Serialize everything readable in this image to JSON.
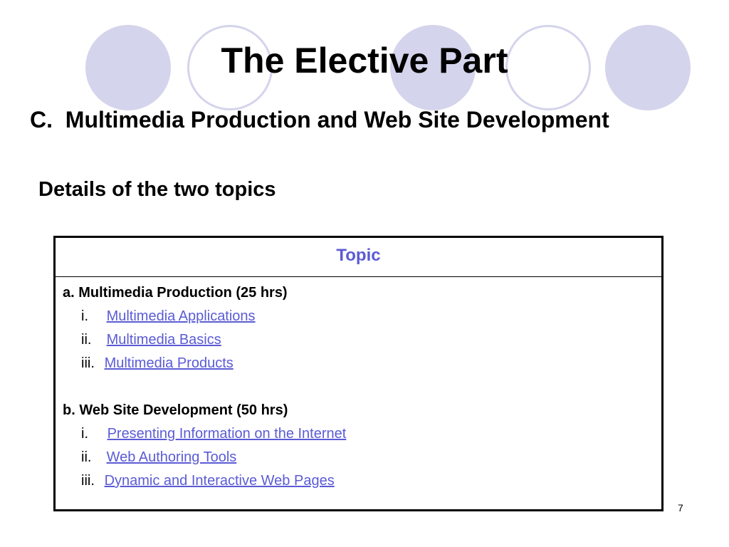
{
  "slide": {
    "title": "The Elective Part",
    "subtitle": "C.  Multimedia Production and Web Site Development",
    "section_heading": "Details of the two topics",
    "page_number": "7"
  },
  "table": {
    "header": "Topic",
    "group_a": {
      "title": "a. Multimedia Production (25 hrs)",
      "items": [
        {
          "num": "i.",
          "text": "Multimedia Applications"
        },
        {
          "num": "ii.",
          "text": "Multimedia Basics"
        },
        {
          "num": "iii.",
          "text": "Multimedia Products"
        }
      ]
    },
    "group_b": {
      "title": "b. Web Site Development (50 hrs)",
      "items": [
        {
          "num": "i.",
          "text": "Presenting Information on the Internet"
        },
        {
          "num": "ii.",
          "text": "Web Authoring Tools"
        },
        {
          "num": "iii.",
          "text": "Dynamic and Interactive Web Pages"
        }
      ]
    }
  },
  "colors": {
    "circle": "#d4d4ec",
    "accent": "#5b5bd6"
  }
}
